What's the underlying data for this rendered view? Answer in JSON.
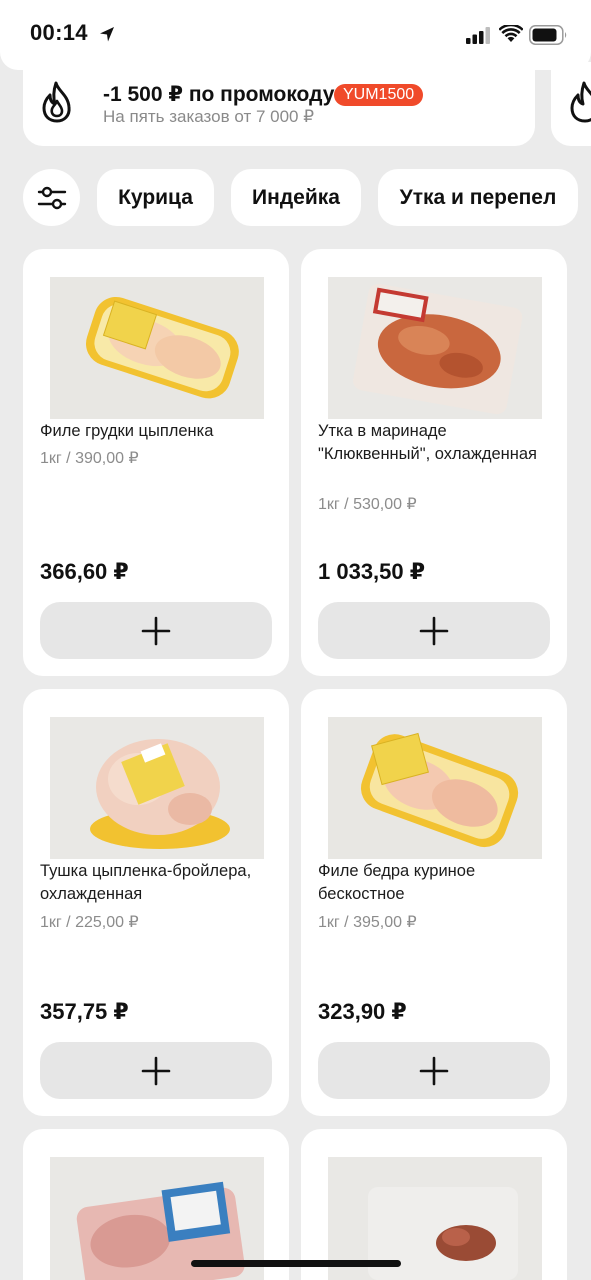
{
  "status_bar": {
    "time": "00:14"
  },
  "promo": {
    "title": "-1 500 ₽ по промокоду",
    "code": "YUM1500",
    "subtitle": "На пять заказов от 7 000 ₽",
    "icon": "flame-icon"
  },
  "categories": [
    "Курица",
    "Индейка",
    "Утка и перепел"
  ],
  "products": [
    {
      "name": "Филе грудки цыпленка",
      "unit_price": "1кг / 390,00 ₽",
      "price": "366,60 ₽"
    },
    {
      "name": "Утка в маринаде \"Клюквенный\", охлажденная",
      "unit_price": "1кг / 530,00 ₽",
      "price": "1 033,50 ₽"
    },
    {
      "name": "Тушка цыпленка-бройлера, охлажденная",
      "unit_price": "1кг / 225,00 ₽",
      "price": "357,75 ₽"
    },
    {
      "name": "Филе бедра куриное бескостное",
      "unit_price": "1кг / 395,00 ₽",
      "price": "323,90 ₽"
    }
  ],
  "colors": {
    "accent": "#f04a2a",
    "background": "#ebebeb",
    "card": "#ffffff",
    "button": "#e6e6e6"
  }
}
